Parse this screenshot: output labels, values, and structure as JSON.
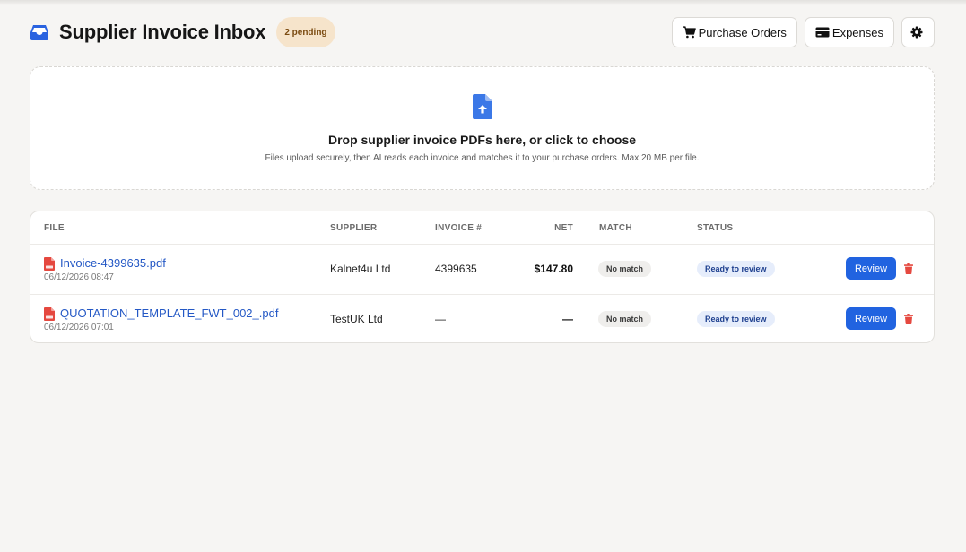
{
  "header": {
    "title": "Supplier Invoice Inbox",
    "pending_badge": "2 pending",
    "purchase_orders_label": "Purchase Orders",
    "expenses_label": "Expenses"
  },
  "dropzone": {
    "title": "Drop supplier invoice PDFs here, or click to choose",
    "subtitle": "Files upload securely, then AI reads each invoice and matches it to your purchase orders. Max 20 MB per file."
  },
  "table": {
    "columns": {
      "file": "FILE",
      "supplier": "SUPPLIER",
      "invoice": "INVOICE #",
      "net": "NET",
      "match": "MATCH",
      "status": "STATUS"
    },
    "rows": [
      {
        "file": "Invoice-4399635.pdf",
        "date": "06/12/2026 08:47",
        "supplier": "Kalnet4u Ltd",
        "invoice": "4399635",
        "net": "$147.80",
        "match": "No match",
        "status": "Ready to review",
        "action": "Review"
      },
      {
        "file": "QUOTATION_TEMPLATE_FWT_002_.pdf",
        "date": "06/12/2026 07:01",
        "supplier": "TestUK Ltd",
        "invoice": "—",
        "net": "—",
        "match": "No match",
        "status": "Ready to review",
        "action": "Review"
      }
    ]
  },
  "colors": {
    "accent": "#2163e0",
    "link": "#2458c5",
    "pdf_red": "#e5483f",
    "pending_bg": "#f6e4cb",
    "status_bg": "#e6edfb"
  },
  "icons": {
    "logo": "inbox-tray-icon",
    "purchase_orders": "cart-icon",
    "expenses": "credit-card-icon",
    "settings": "gear-icon",
    "upload": "file-upload-icon",
    "file": "pdf-file-icon",
    "delete": "trash-icon"
  }
}
